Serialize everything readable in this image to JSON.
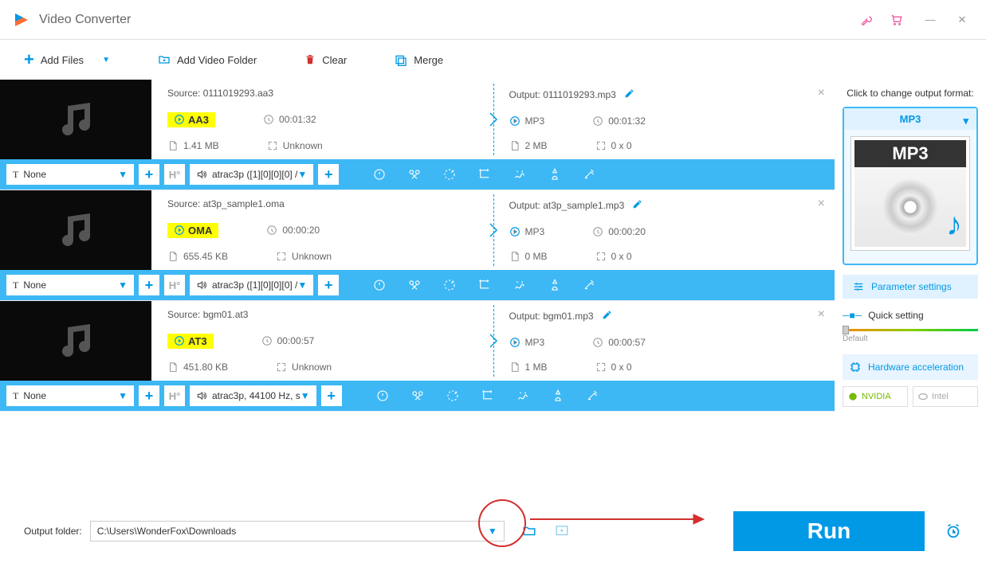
{
  "app": {
    "title": "Video Converter"
  },
  "toolbar": {
    "add_files": "Add Files",
    "add_folder": "Add Video Folder",
    "clear": "Clear",
    "merge": "Merge"
  },
  "items": [
    {
      "source_label": "Source: 0111019293.aa3",
      "src_format": "AA3",
      "src_duration": "00:01:32",
      "src_size": "1.41 MB",
      "src_dimensions": "Unknown",
      "output_label": "Output: 0111019293.mp3",
      "out_format": "MP3",
      "out_duration": "00:01:32",
      "out_size": "2 MB",
      "out_dimensions": "0 x 0",
      "subtitle": "None",
      "audio": "atrac3p ([1][0][0][0] / "
    },
    {
      "source_label": "Source: at3p_sample1.oma",
      "src_format": "OMA",
      "src_duration": "00:00:20",
      "src_size": "655.45 KB",
      "src_dimensions": "Unknown",
      "output_label": "Output: at3p_sample1.mp3",
      "out_format": "MP3",
      "out_duration": "00:00:20",
      "out_size": "0 MB",
      "out_dimensions": "0 x 0",
      "subtitle": "None",
      "audio": "atrac3p ([1][0][0][0] / "
    },
    {
      "source_label": "Source: bgm01.at3",
      "src_format": "AT3",
      "src_duration": "00:00:57",
      "src_size": "451.80 KB",
      "src_dimensions": "Unknown",
      "output_label": "Output: bgm01.mp3",
      "out_format": "MP3",
      "out_duration": "00:00:57",
      "out_size": "1 MB",
      "out_dimensions": "0 x 0",
      "subtitle": "None",
      "audio": "atrac3p, 44100 Hz, s"
    }
  ],
  "sidebar": {
    "title": "Click to change output format:",
    "format": "MP3",
    "format_img_label": "MP3",
    "param_settings": "Parameter settings",
    "quick_setting": "Quick setting",
    "slider_label": "Default",
    "hw_accel": "Hardware acceleration",
    "nvidia": "NVIDIA",
    "intel": "Intel"
  },
  "bottom": {
    "output_folder_label": "Output folder:",
    "output_folder_value": "C:\\Users\\WonderFox\\Downloads",
    "run": "Run"
  }
}
